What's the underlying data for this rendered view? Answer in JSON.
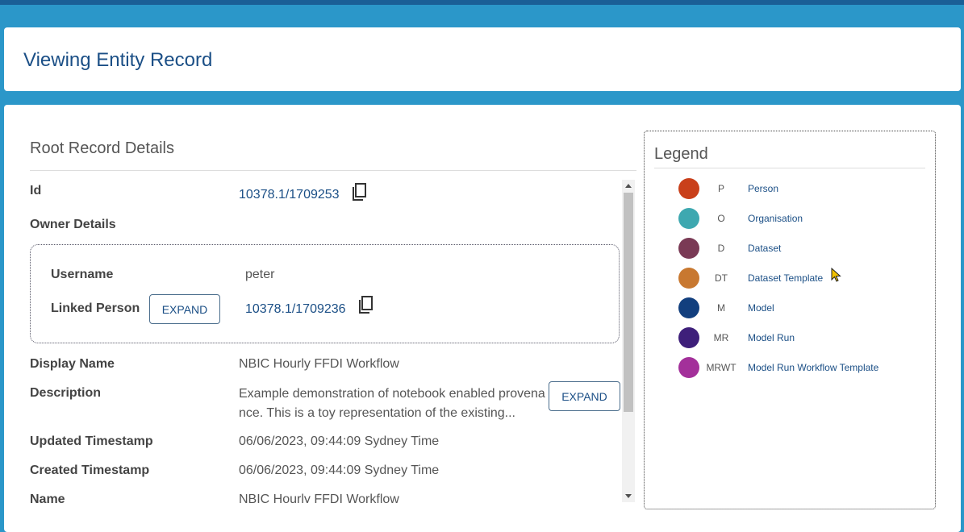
{
  "header": {
    "title": "Viewing Entity Record"
  },
  "details": {
    "section_title": "Root Record Details",
    "id_label": "Id",
    "id_value": "10378.1/1709253",
    "owner_label": "Owner Details",
    "owner": {
      "username_label": "Username",
      "username_value": "peter",
      "linked_person_label": "Linked Person",
      "expand_label": "EXPAND",
      "linked_person_value": "10378.1/1709236"
    },
    "display_name_label": "Display Name",
    "display_name_value": "NBIC Hourly FFDI Workflow",
    "description_label": "Description",
    "description_line1": "Example demonstration of notebook enabled provena",
    "description_line2": "nce. This is a toy representation of the existing...",
    "description_expand_label": "EXPAND",
    "updated_label": "Updated Timestamp",
    "updated_value": "06/06/2023, 09:44:09 Sydney Time",
    "created_label": "Created Timestamp",
    "created_value": "06/06/2023, 09:44:09 Sydney Time",
    "name_label": "Name",
    "name_value": "NBIC Hourly FFDI Workflow"
  },
  "legend": {
    "title": "Legend",
    "items": [
      {
        "abbr": "P",
        "name": "Person",
        "color": "#c9401b"
      },
      {
        "abbr": "O",
        "name": "Organisation",
        "color": "#3ea8b0"
      },
      {
        "abbr": "D",
        "name": "Dataset",
        "color": "#7a3a55"
      },
      {
        "abbr": "DT",
        "name": "Dataset Template",
        "color": "#c87830"
      },
      {
        "abbr": "M",
        "name": "Model",
        "color": "#123f7e"
      },
      {
        "abbr": "MR",
        "name": "Model Run",
        "color": "#3e1f7a"
      },
      {
        "abbr": "MRWT",
        "name": "Model Run Workflow Template",
        "color": "#a3309a"
      }
    ]
  }
}
